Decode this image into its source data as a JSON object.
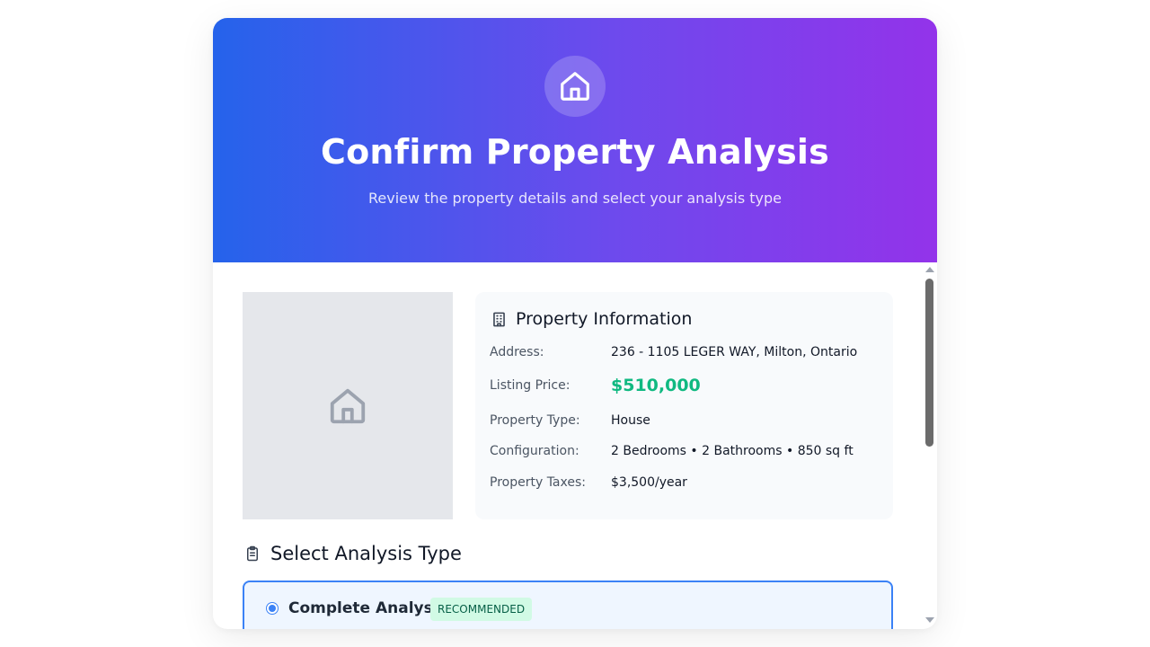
{
  "header": {
    "icon": "home-icon",
    "title": "Confirm Property Analysis",
    "subtitle": "Review the property details and select your analysis type"
  },
  "photo": {
    "icon": "home-icon"
  },
  "property_info": {
    "title": "Property Information",
    "icon": "building-icon",
    "rows": [
      {
        "label": "Address:",
        "value": "236 - 1105 LEGER WAY, Milton, Ontario"
      },
      {
        "label": "Listing Price:",
        "value": "$510,000"
      },
      {
        "label": "Property Type:",
        "value": "House"
      },
      {
        "label": "Configuration:",
        "value": "2 Bedrooms • 2 Bathrooms • 850 sq ft"
      },
      {
        "label": "Property Taxes:",
        "value": "$3,500/year"
      }
    ]
  },
  "analysis_section": {
    "title": "Select Analysis Type",
    "icon": "clipboard-icon",
    "options": [
      {
        "title": "Complete Analysis",
        "badge": "RECOMMENDED",
        "selected": true
      }
    ]
  },
  "colors": {
    "gradient_start": "#2563eb",
    "gradient_end": "#9333ea",
    "price": "#10b981",
    "accent": "#3b82f6",
    "badge_bg": "#d1fae5"
  }
}
